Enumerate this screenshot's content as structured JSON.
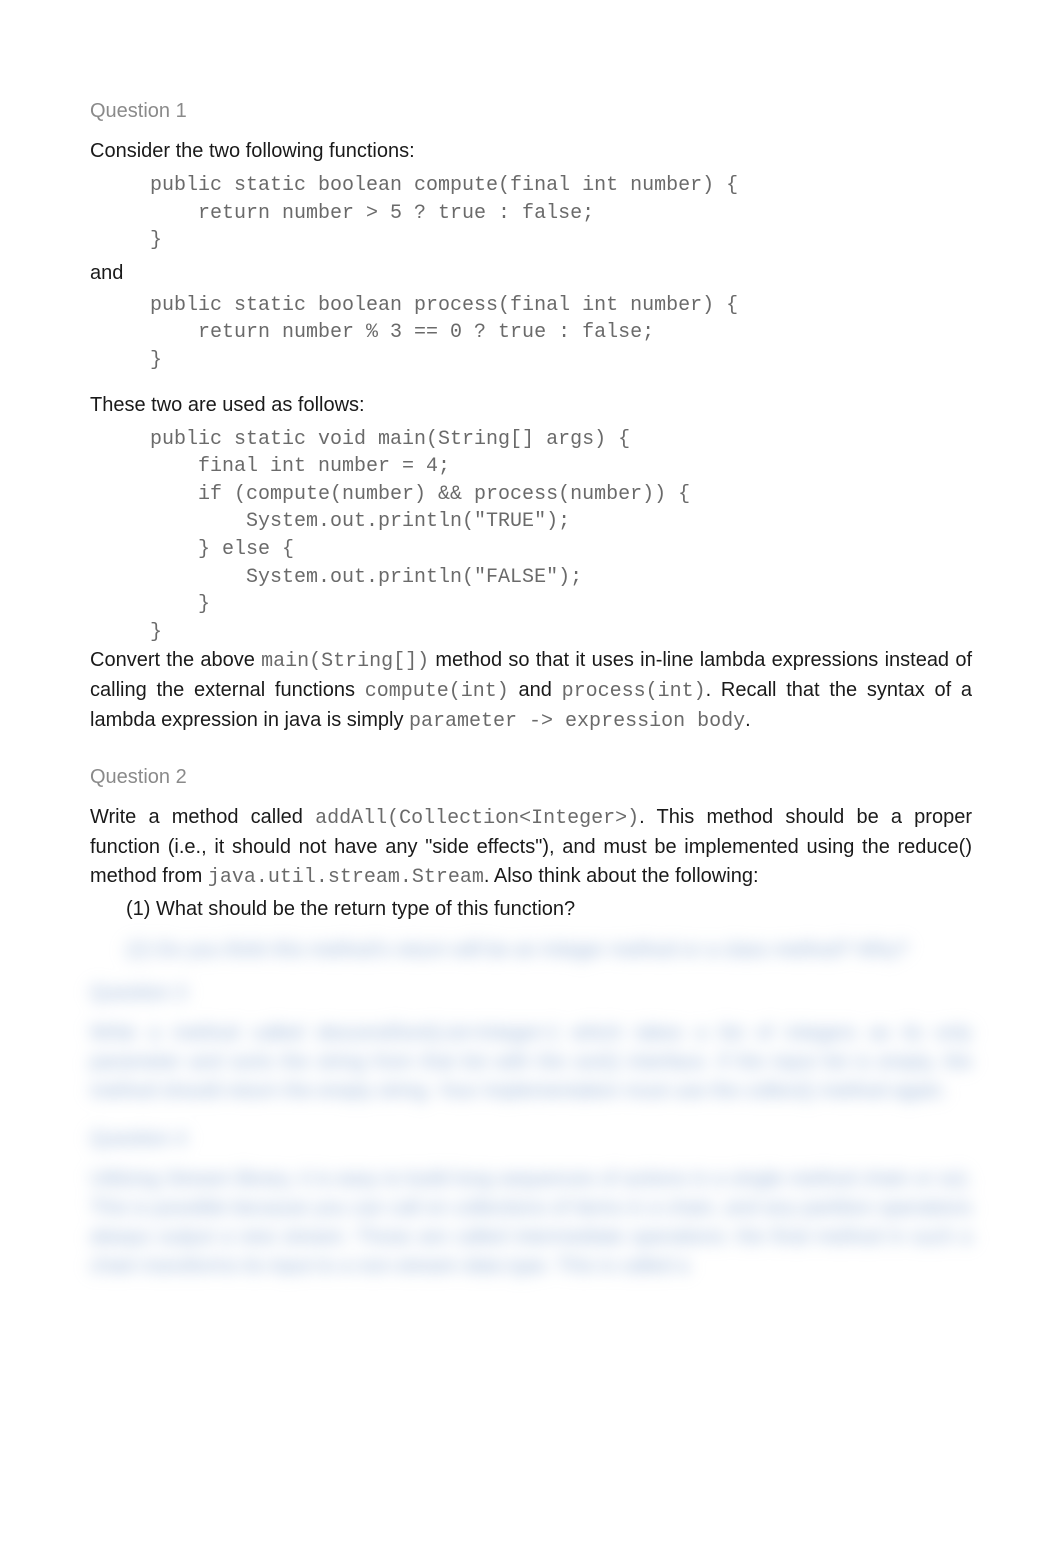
{
  "q1": {
    "heading": "Question 1",
    "intro": "Consider the two following functions:",
    "code1": "public static boolean compute(final int number) {\n    return number > 5 ? true : false;\n}",
    "and": "and",
    "code2": "public static boolean process(final int number) {\n    return number % 3 == 0 ? true : false;\n}",
    "used": "These two are used as follows:",
    "code3": "public static void main(String[] args) {\n    final int number = 4;\n    if (compute(number) && process(number)) {\n        System.out.println(\"TRUE\");\n    } else {\n        System.out.println(\"FALSE\");\n    }\n}",
    "conv_a": "Convert the above ",
    "conv_code_a": "main(String[])",
    "conv_b": " method so that it uses in-line lambda expressions instead of calling the external functions ",
    "conv_code_b": "compute(int)",
    "conv_c": " and ",
    "conv_code_c": "process(int)",
    "conv_d": ". Recall that the syntax of a lambda expression in java is simply ",
    "conv_code_d": "parameter -> expression body",
    "conv_e": "."
  },
  "q2": {
    "heading": "Question 2",
    "p_a": "Write a method called ",
    "p_code_a": "addAll(Collection<Integer>)",
    "p_b": ". This method should be a proper function (i.e., it should not have any \"side effects\"), and must be implemented using the reduce() method from ",
    "p_code_b": "java.util.stream.Stream",
    "p_c": ". Also think about the following:",
    "item1": "(1) What should be the return type of this function?"
  },
  "blurred": {
    "item2": "(2) Do you think this method's return will be an Integer method or a class method? Why?",
    "q3_heading": "Question 3",
    "q3_body": "Write a method called descendSort(List<Integer>) which takes a list of integers as its only parameter and sorts the string from that list with the sort() interface. If the input list is empty, the method should return the empty string. Your implementation must use the collect() method again.",
    "q4_heading": "Question 4",
    "q4_body": "Utilizing Stream library, it is easy to build long sequences of actions in a single method chain or so). This is possible because you can call on collections of items in a chain, and any partition operations always output a new stream. Those are called intermediate operations: the final method in such a chain transforms its input to a non-stream data type. This is called a"
  }
}
